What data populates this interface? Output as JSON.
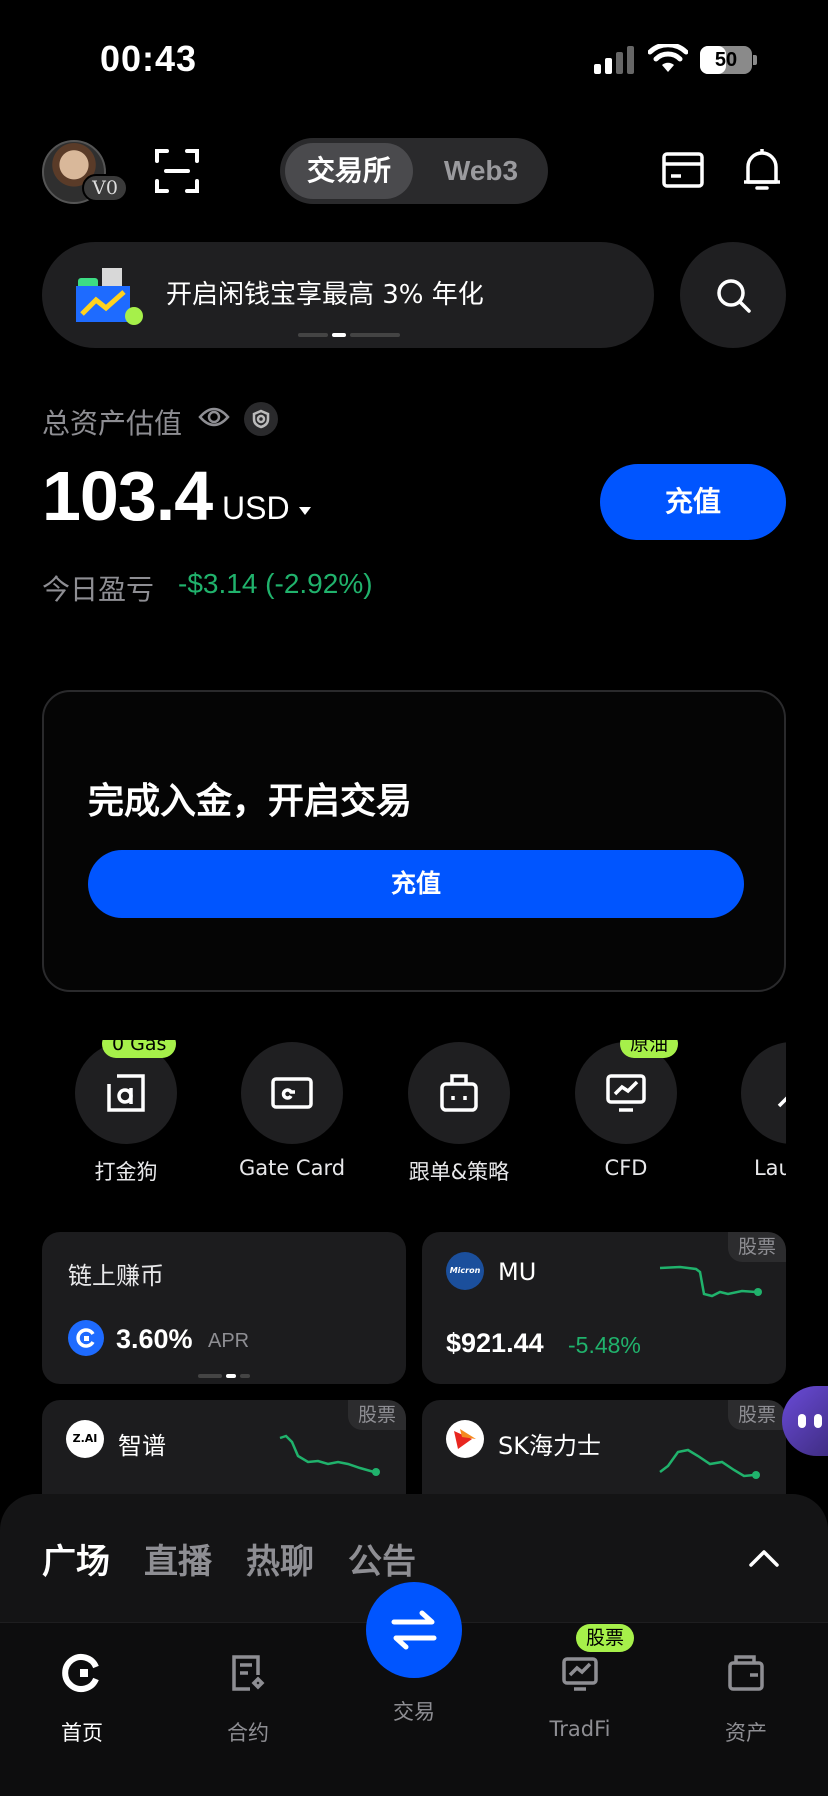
{
  "status": {
    "time": "00:43",
    "battery": "50",
    "battery_level": 0.5
  },
  "header": {
    "vip_label": "V0",
    "tabs": [
      {
        "label": "交易所"
      },
      {
        "label": "Web3"
      }
    ]
  },
  "banner": {
    "text": "开启闲钱宝享最高 3% 年化"
  },
  "assets": {
    "title": "总资产估值",
    "total": "103.4",
    "currency": "USD",
    "deposit_label": "充值",
    "pnl_label": "今日盈亏",
    "pnl_value": "-$3.14 (-2.92%)"
  },
  "fund_card": {
    "title": "完成入金，开启交易",
    "button": "充值"
  },
  "shortcuts": [
    {
      "label": "打金狗",
      "tag": "0 Gas",
      "icon": "alpha-icon"
    },
    {
      "label": "Gate Card",
      "tag": "",
      "icon": "card-icon"
    },
    {
      "label": "跟单&策略",
      "tag": "",
      "icon": "robot-icon"
    },
    {
      "label": "CFD",
      "tag": "原油",
      "icon": "chart-monitor-icon"
    },
    {
      "label": "Launch",
      "tag": "",
      "icon": "launch-icon"
    }
  ],
  "cards": {
    "earn": {
      "title": "链上赚币",
      "apr_value": "3.60%",
      "apr_label": "APR"
    },
    "mu": {
      "tag": "股票",
      "name": "MU",
      "logo_text": "Micron",
      "price": "$921.44",
      "change": "-5.48%"
    },
    "zhipu": {
      "tag": "股票",
      "name": "智谱",
      "logo_text": "Z.AI"
    },
    "sk": {
      "tag": "股票",
      "name": "SK海力士"
    }
  },
  "social_tabs": [
    "广场",
    "直播",
    "热聊",
    "公告"
  ],
  "nav": {
    "home": "首页",
    "futures": "合约",
    "trade": "交易",
    "tradfi": "TradFi",
    "tradfi_tag": "股票",
    "assets": "资产"
  },
  "colors": {
    "accent": "#0055ff",
    "positive": "#20b26c",
    "tag_green": "#a6f04a"
  }
}
